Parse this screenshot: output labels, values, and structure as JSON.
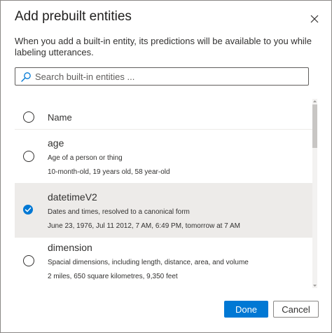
{
  "dialog": {
    "title": "Add prebuilt entities",
    "description": "When you add a built-in entity, its predictions will be available to you while labeling utterances.",
    "close_icon": "close-icon"
  },
  "search": {
    "placeholder": "Search built-in entities ...",
    "value": "",
    "icon": "search-icon"
  },
  "list": {
    "header": {
      "label": "Name",
      "checked": false
    },
    "rows": [
      {
        "name": "age",
        "description": "Age of a person or thing",
        "example": "10-month-old, 19 years old, 58 year-old",
        "checked": false
      },
      {
        "name": "datetimeV2",
        "description": "Dates and times, resolved to a canonical form",
        "example": "June 23, 1976, Jul 11 2012, 7 AM, 6:49 PM, tomorrow at 7 AM",
        "checked": true
      },
      {
        "name": "dimension",
        "description": "Spacial dimensions, including length, distance, area, and volume",
        "example": "2 miles, 650 square kilometres, 9,350 feet",
        "checked": false
      }
    ]
  },
  "footer": {
    "done_label": "Done",
    "cancel_label": "Cancel"
  },
  "colors": {
    "accent": "#0078d4",
    "selected_row": "#edebe9"
  }
}
